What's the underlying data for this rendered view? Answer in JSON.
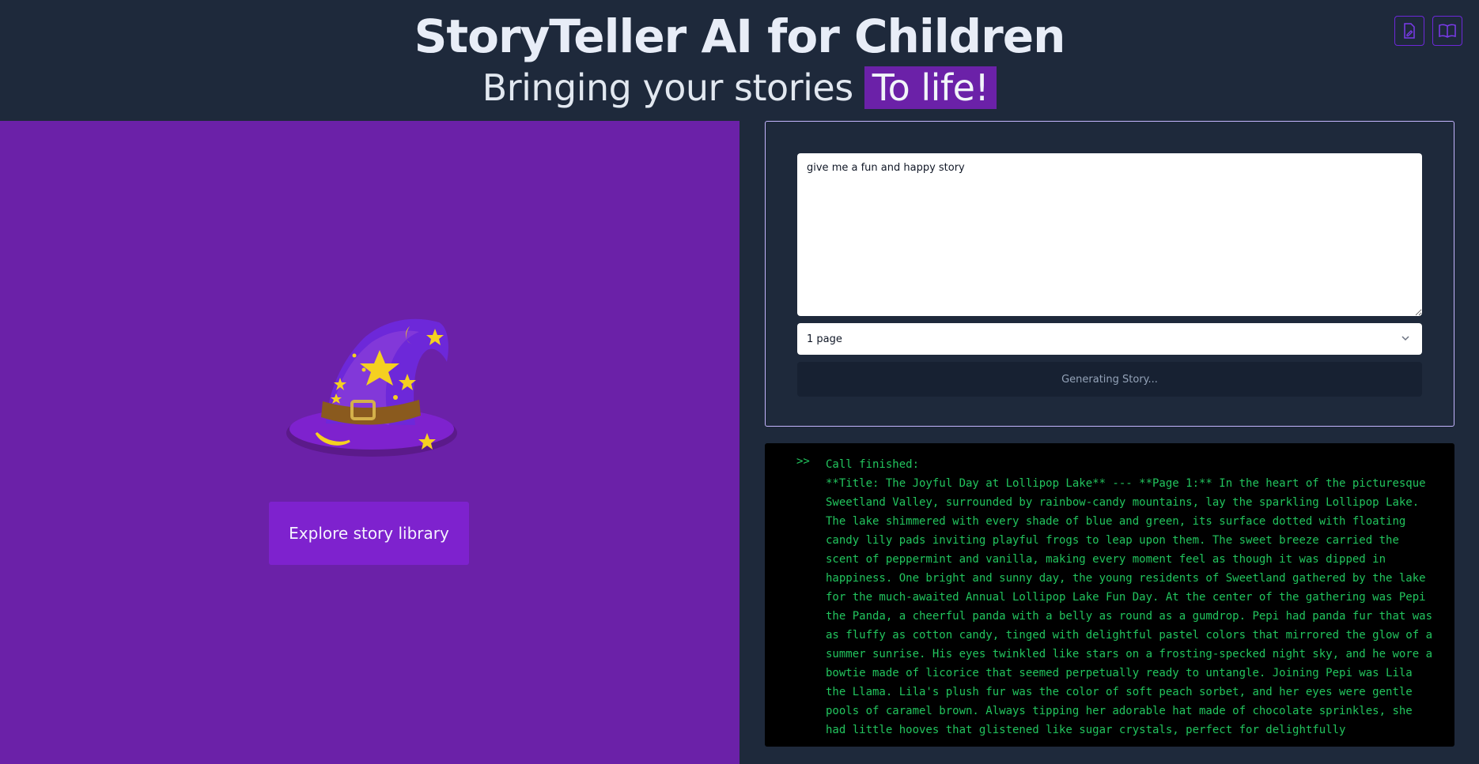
{
  "header": {
    "title": "StoryTeller AI for Children",
    "subtitle_prefix": "Bringing your stories",
    "subtitle_highlight": "To life!",
    "buttons": [
      {
        "icon": "edit-document-icon"
      },
      {
        "icon": "book-open-icon"
      }
    ]
  },
  "colors": {
    "background": "#1e293b",
    "left_panel": "#6b21a8",
    "accent": "#7e22ce",
    "console_text": "#22c55e"
  },
  "left": {
    "hat_icon": "wizard-hat-icon",
    "explore_label": "Explore story library"
  },
  "form": {
    "prompt_value": "give me a fun and happy story",
    "pages_selected": "1 page",
    "generate_label": "Generating Story..."
  },
  "console": {
    "prompt_symbol": ">>",
    "status": "Call finished:",
    "output": "**Title: The Joyful Day at Lollipop Lake** --- **Page 1:** In the heart of the picturesque Sweetland Valley, surrounded by rainbow-candy mountains, lay the sparkling Lollipop Lake. The lake shimmered with every shade of blue and green, its surface dotted with floating candy lily pads inviting playful frogs to leap upon them. The sweet breeze carried the scent of peppermint and vanilla, making every moment feel as though it was dipped in happiness. One bright and sunny day, the young residents of Sweetland gathered by the lake for the much-awaited Annual Lollipop Lake Fun Day. At the center of the gathering was Pepi the Panda, a cheerful panda with a belly as round as a gumdrop. Pepi had panda fur that was as fluffy as cotton candy, tinged with delightful pastel colors that mirrored the glow of a summer sunrise. His eyes twinkled like stars on a frosting-specked night sky, and he wore a bowtie made of licorice that seemed perpetually ready to untangle. Joining Pepi was Lila the Llama. Lila's plush fur was the color of soft peach sorbet, and her eyes were gentle pools of caramel brown. Always tipping her adorable hat made of chocolate sprinkles, she had little hooves that glistened like sugar crystals, perfect for delightfully"
  }
}
